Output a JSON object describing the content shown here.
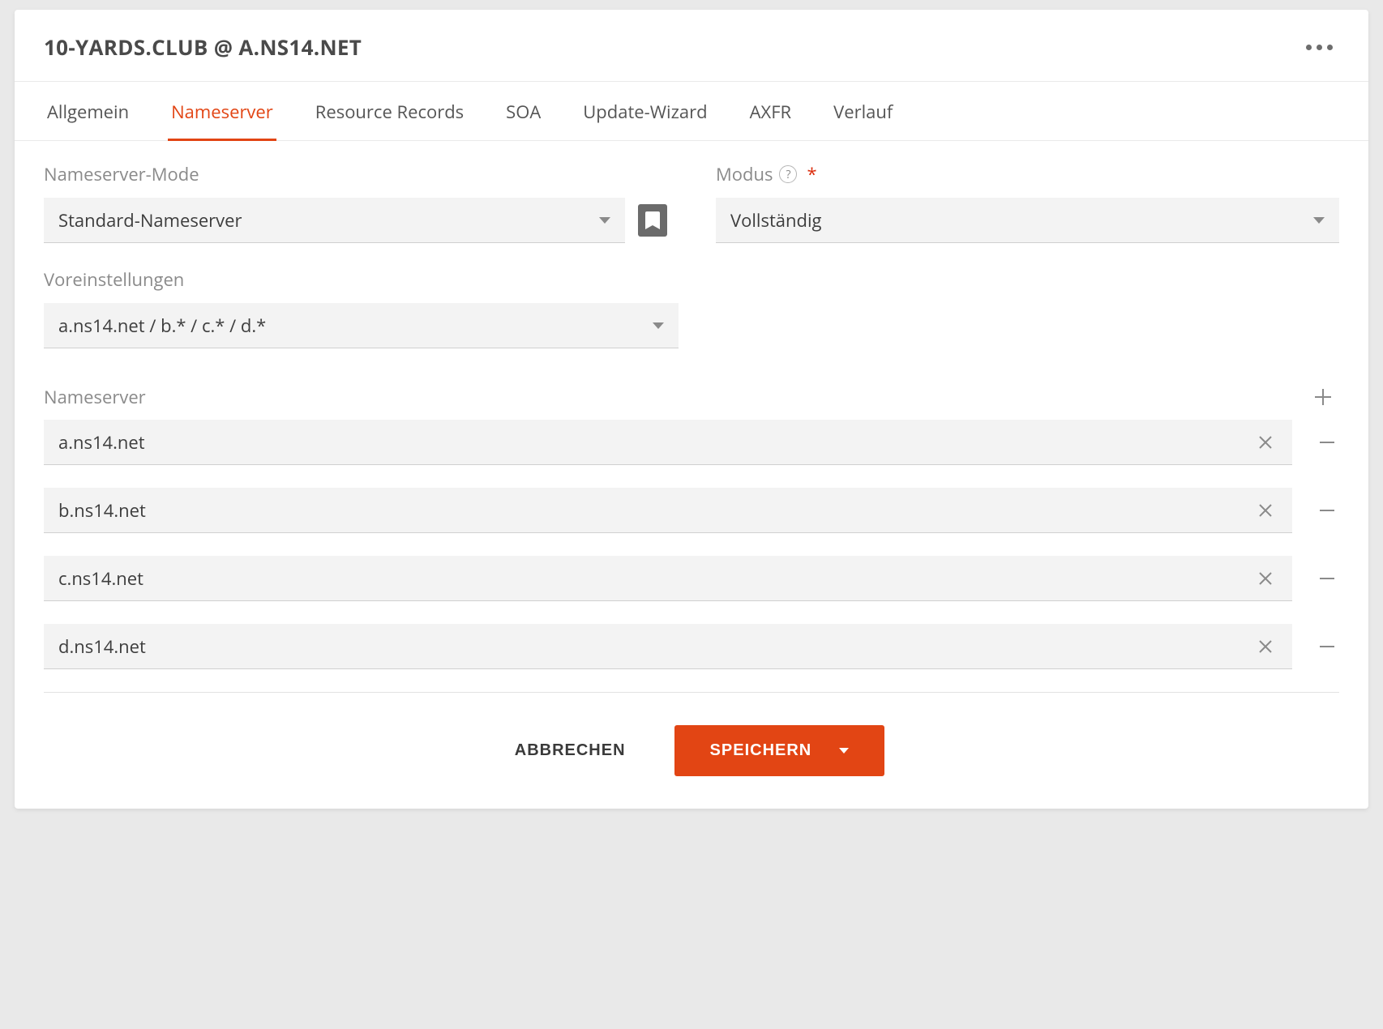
{
  "header": {
    "title": "10-YARDS.CLUB @ A.NS14.NET"
  },
  "tabs": [
    {
      "label": "Allgemein",
      "active": false
    },
    {
      "label": "Nameserver",
      "active": true
    },
    {
      "label": "Resource Records",
      "active": false
    },
    {
      "label": "SOA",
      "active": false
    },
    {
      "label": "Update-Wizard",
      "active": false
    },
    {
      "label": "AXFR",
      "active": false
    },
    {
      "label": "Verlauf",
      "active": false
    }
  ],
  "form": {
    "ns_mode_label": "Nameserver-Mode",
    "ns_mode_value": "Standard-Nameserver",
    "modus_label": "Modus",
    "modus_value": "Vollständig",
    "preset_label": "Voreinstellungen",
    "preset_value": "a.ns14.net / b.* / c.* / d.*",
    "ns_list_label": "Nameserver",
    "nameservers": [
      {
        "value": "a.ns14.net"
      },
      {
        "value": "b.ns14.net"
      },
      {
        "value": "c.ns14.net"
      },
      {
        "value": "d.ns14.net"
      }
    ]
  },
  "actions": {
    "cancel": "ABBRECHEN",
    "save": "SPEICHERN"
  }
}
